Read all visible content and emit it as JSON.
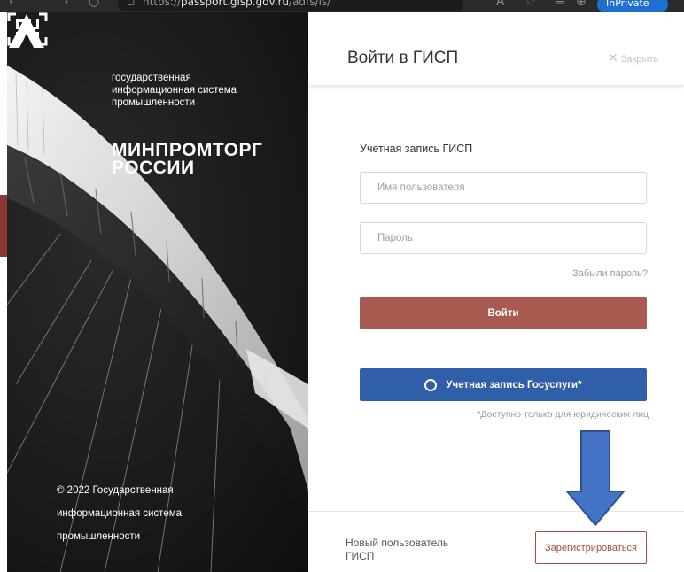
{
  "browser": {
    "url_prefix": "https://",
    "url_domain": "passport.gisp.gov.ru",
    "url_path": "/adfs/ls/",
    "profile_label": "InPrivate"
  },
  "hero": {
    "gisp_org_lines": [
      "государственная",
      "информационная система",
      "промышленности"
    ],
    "ministry_lines": [
      "МИНПРОМТОРГ",
      "РОССИИ"
    ],
    "copyright_lines": [
      "© 2022 Государственная",
      "информационная система",
      "промышленности"
    ]
  },
  "header": {
    "title": "Войти в ГИСП",
    "close_label": "Закрыть"
  },
  "form": {
    "section_label": "Учетная запись ГИСП",
    "username_placeholder": "Имя пользователя",
    "password_placeholder": "Пароль",
    "forgot_label": "Забыли пароль?",
    "login_label": "Войти",
    "gosuslugi_label": "Учетная запись Госуслуги*",
    "gosuslugi_note": "*Доступно только для юридических лиц"
  },
  "footer": {
    "new_user_lines": [
      "Новый пользователь",
      "ГИСП"
    ],
    "register_label": "Зарегистрироваться"
  },
  "colors": {
    "login_button": "#a95a50",
    "gosuslugi_button": "#2f5fa8",
    "register_border": "#a84a42",
    "annotation_arrow": "#4472c4"
  },
  "icons": {
    "close": "close-icon",
    "gosuslugi": "gosuslugi-circle-icon",
    "annotation": "down-arrow-icon"
  }
}
